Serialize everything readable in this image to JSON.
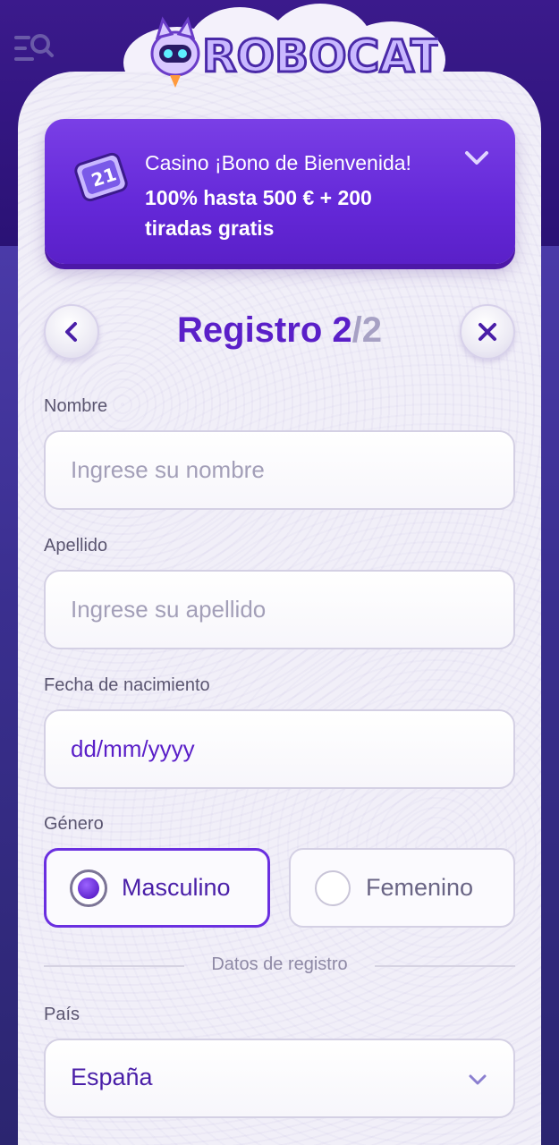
{
  "header": {
    "menu_icon": "menu-search-icon",
    "logo_text": "ROBOCAT"
  },
  "bonus": {
    "line1": "Casino ¡Bono de Bienvenida!",
    "line2": "100% hasta 500 € + 200 tiradas gratis",
    "icon": "ticket-icon",
    "expand_icon": "chevron-down-icon"
  },
  "step": {
    "title": "Registro",
    "current": "2",
    "total": "/2"
  },
  "form": {
    "first_name": {
      "label": "Nombre",
      "placeholder": "Ingrese su nombre"
    },
    "last_name": {
      "label": "Apellido",
      "placeholder": "Ingrese su apellido"
    },
    "birthdate": {
      "label": "Fecha de nacimiento",
      "value": "dd/mm/yyyy"
    },
    "gender": {
      "label": "Género",
      "options": [
        "Masculino",
        "Femenino"
      ],
      "selected": "Masculino"
    },
    "section_divider": "Datos de registro",
    "country": {
      "label": "País",
      "value": "España"
    }
  },
  "colors": {
    "accent": "#5a1fc8",
    "bonus_bg": "#6a2fe0",
    "card_bg": "#f1eff8"
  }
}
